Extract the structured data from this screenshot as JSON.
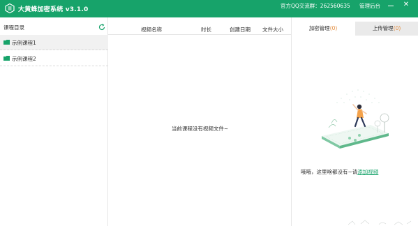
{
  "titlebar": {
    "app_title": "大黄蜂加密系统 v3.1.0",
    "qq_group": "官方QQ交流群：262560635",
    "admin_label": "管理后台",
    "close_glyph": "✕",
    "bg_color": "#17a36a"
  },
  "left": {
    "header": "课程目录",
    "refresh_icon": "refresh-icon",
    "courses": [
      {
        "name": "示例课程1",
        "selected": true
      },
      {
        "name": "示例课程2",
        "selected": false
      }
    ]
  },
  "mid": {
    "columns": [
      "视频名称",
      "时长",
      "创建日期",
      "文件大小"
    ],
    "empty_message": "当前课程没有视频文件~"
  },
  "right": {
    "tabs": [
      {
        "label": "加密管理",
        "count": "(0)",
        "active": true
      },
      {
        "label": "上传管理",
        "count": "(0)",
        "active": false
      }
    ],
    "hint_text": "哦哦，这里啥都没有~请",
    "hint_link": "添加视频",
    "accent_color": "#17a36a"
  }
}
